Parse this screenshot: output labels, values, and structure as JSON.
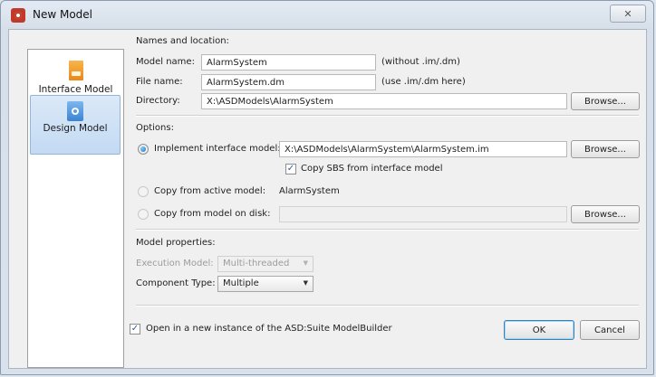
{
  "window": {
    "title": "New Model",
    "close_glyph": "✕"
  },
  "left_panel": {
    "items": [
      {
        "label": "Interface Model",
        "icon": "interface-model-icon",
        "selected": false
      },
      {
        "label": "Design Model",
        "icon": "design-model-icon",
        "selected": true
      }
    ]
  },
  "names": {
    "section": "Names and location:",
    "model_name_label": "Model name:",
    "model_name_value": "AlarmSystem",
    "model_name_hint": "(without .im/.dm)",
    "file_name_label": "File name:",
    "file_name_value": "AlarmSystem.dm",
    "file_name_hint": "(use .im/.dm here)",
    "directory_label": "Directory:",
    "directory_value": "X:\\ASDModels\\AlarmSystem",
    "browse_label": "Browse..."
  },
  "options": {
    "section": "Options:",
    "implement_label": "Implement interface model:",
    "implement_value": "X:\\ASDModels\\AlarmSystem\\AlarmSystem.im",
    "implement_checked": true,
    "copy_sbs_label": "Copy SBS from interface model",
    "copy_sbs_checked": true,
    "copy_active_label": "Copy from active model:",
    "copy_active_value": "AlarmSystem",
    "copy_disk_label": "Copy from model on disk:",
    "copy_disk_value": "",
    "browse_label": "Browse..."
  },
  "properties": {
    "section": "Model properties:",
    "execution_label": "Execution Model:",
    "execution_value": "Multi-threaded",
    "component_label": "Component Type:",
    "component_value": "Multiple"
  },
  "footer": {
    "open_new_label": "Open in a new instance of the ASD:Suite ModelBuilder",
    "open_new_checked": true,
    "ok_label": "OK",
    "cancel_label": "Cancel"
  },
  "colors": {
    "accent": "#1b6fb8",
    "title_bar": "#dbe3ed"
  }
}
